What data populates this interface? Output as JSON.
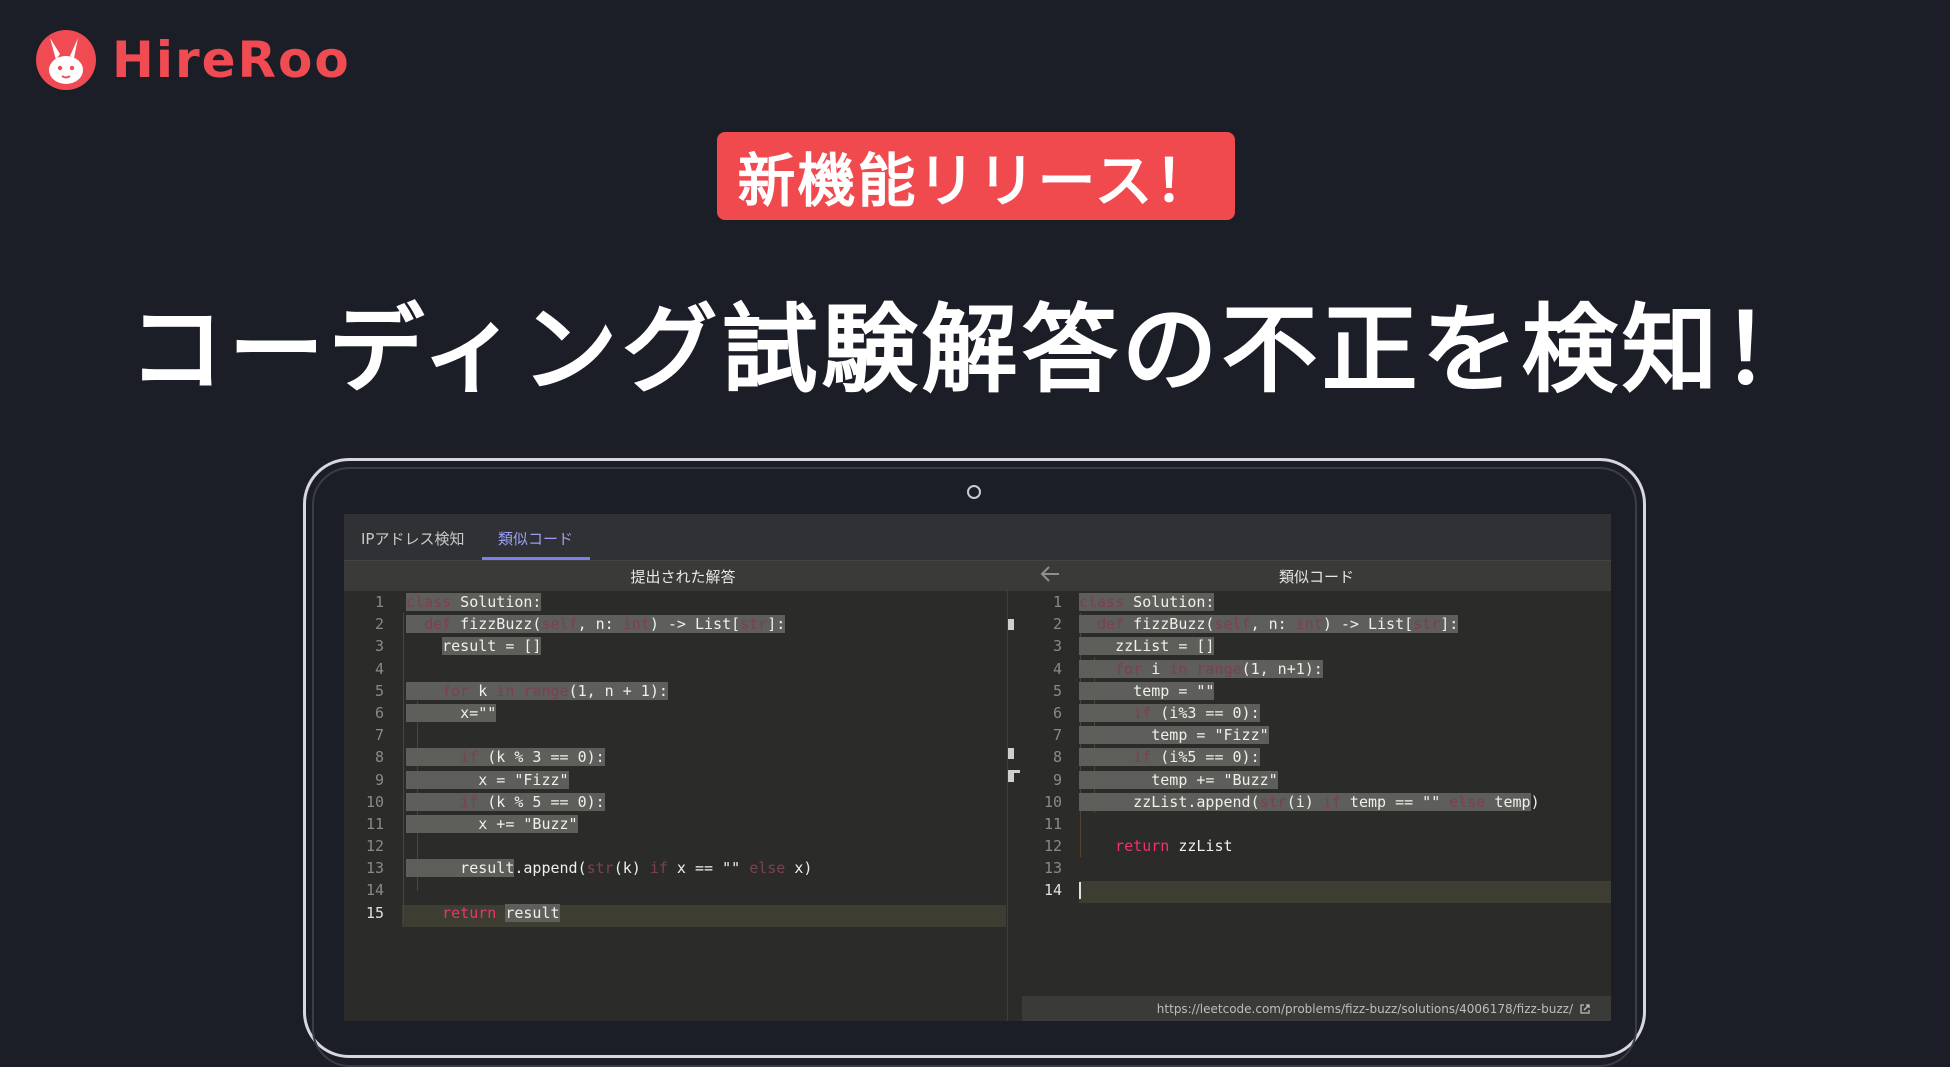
{
  "brand": {
    "name": "HireRoo",
    "logo_icon": "kangaroo-icon",
    "accent_color": "#f04a52"
  },
  "badge": {
    "text": "新機能リリース！"
  },
  "headline": {
    "text": "コーディング試験解答の不正を検知！"
  },
  "app": {
    "tabs": [
      {
        "label": "IPアドレス検知",
        "active": false
      },
      {
        "label": "類似コード",
        "active": true
      }
    ],
    "left_pane": {
      "title": "提出された解答",
      "lines": [
        {
          "n": "1",
          "code": "class Solution:"
        },
        {
          "n": "2",
          "code": "    def fizzBuzz(self, n: int) -> List[str]:"
        },
        {
          "n": "3",
          "code": "        result = []"
        },
        {
          "n": "4",
          "code": ""
        },
        {
          "n": "5",
          "code": "        for k in range(1, n + 1):"
        },
        {
          "n": "6",
          "code": "            x=\"\""
        },
        {
          "n": "7",
          "code": ""
        },
        {
          "n": "8",
          "code": "            if (k % 3 == 0):"
        },
        {
          "n": "9",
          "code": "              x = \"Fizz\""
        },
        {
          "n": "10",
          "code": "            if (k % 5 == 0):"
        },
        {
          "n": "11",
          "code": "              x += \"Buzz\""
        },
        {
          "n": "12",
          "code": ""
        },
        {
          "n": "13",
          "code": "            result.append(str(k) if x == \"\" else x)"
        },
        {
          "n": "14",
          "code": ""
        },
        {
          "n": "15",
          "code": "        return result"
        }
      ]
    },
    "back_icon": "arrow-left-icon",
    "right_pane": {
      "title": "類似コード",
      "lines": [
        {
          "n": "1",
          "code": "class Solution:"
        },
        {
          "n": "2",
          "code": "    def fizzBuzz(self, n: int) -> List[str]:"
        },
        {
          "n": "3",
          "code": "        zzList = []"
        },
        {
          "n": "4",
          "code": "        for i in range(1, n+1):"
        },
        {
          "n": "5",
          "code": "            temp = \"\""
        },
        {
          "n": "6",
          "code": "            if (i%3 == 0):"
        },
        {
          "n": "7",
          "code": "                temp = \"Fizz\""
        },
        {
          "n": "8",
          "code": "            if (i%5 == 0):"
        },
        {
          "n": "9",
          "code": "                temp += \"Buzz\""
        },
        {
          "n": "10",
          "code": "            zzList.append(str(i) if temp == \"\" else temp)"
        },
        {
          "n": "11",
          "code": ""
        },
        {
          "n": "12",
          "code": "        return zzList"
        },
        {
          "n": "13",
          "code": ""
        },
        {
          "n": "14",
          "code": ""
        }
      ]
    },
    "source_url": "https://leetcode.com/problems/fizz-buzz/solutions/4006178/fizz-buzz/",
    "external_link_icon": "external-link-icon"
  }
}
